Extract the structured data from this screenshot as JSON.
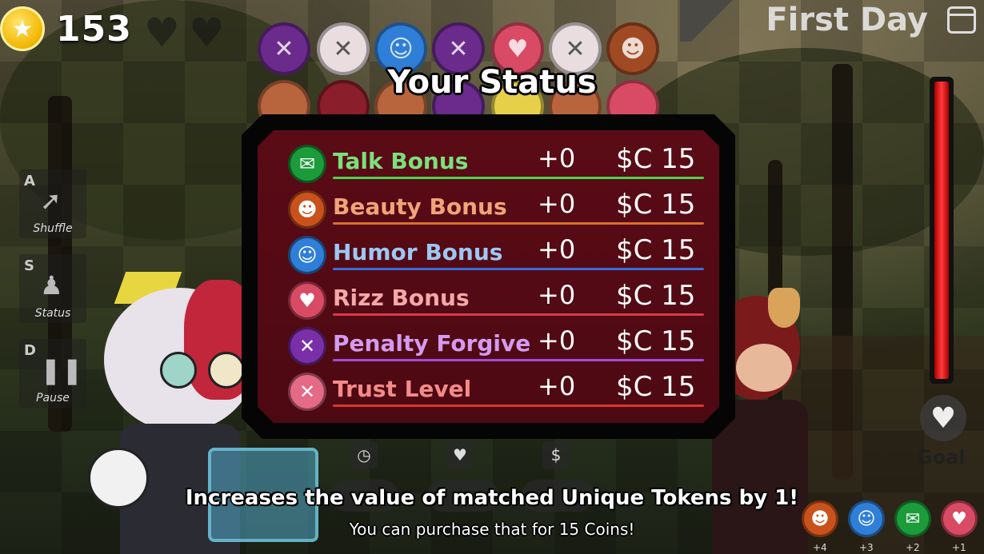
{
  "hud": {
    "coins": "153",
    "coin_icon": "star-coin-icon",
    "day_title": "First Day",
    "calendar_icon": "calendar-icon"
  },
  "controls": [
    {
      "key": "A",
      "label": "Shuffle",
      "icon": "shuffle-icon"
    },
    {
      "key": "S",
      "label": "Status",
      "icon": "status-icon"
    },
    {
      "key": "D",
      "label": "Pause",
      "icon": "pause-icon"
    }
  ],
  "status": {
    "title": "Your Status",
    "rows": [
      {
        "name": "Talk Bonus",
        "bonus": "+0",
        "price": "$C 15",
        "color": "#7be07b",
        "icon_color": "#1c9b3a",
        "icon": "speech-bubble-icon"
      },
      {
        "name": "Beauty Bonus",
        "bonus": "+0",
        "price": "$C 15",
        "color": "#f0a478",
        "icon_color": "#c9521c",
        "icon": "beauty-icon"
      },
      {
        "name": "Humor Bonus",
        "bonus": "+0",
        "price": "$C 15",
        "color": "#9cc8f4",
        "icon_color": "#2f7fd8",
        "icon": "smiley-icon"
      },
      {
        "name": "Rizz Bonus",
        "bonus": "+0",
        "price": "$C 15",
        "color": "#f4a8a8",
        "icon_color": "#d94a64",
        "icon": "heart-face-icon"
      },
      {
        "name": "Penalty Forgive",
        "bonus": "+0",
        "price": "$C 15",
        "color": "#d39af0",
        "icon_color": "#7a2fa8",
        "icon": "x-icon"
      },
      {
        "name": "Trust Level",
        "bonus": "+0",
        "price": "$C 15",
        "color": "#f48a8a",
        "icon_color": "#e46a86",
        "icon": "dizzy-face-icon"
      }
    ]
  },
  "goal": {
    "label": "Goal",
    "icon": "heart-icon"
  },
  "tooltip": {
    "main": "Increases the value of matched Unique Tokens by 1!",
    "sub": "You can purchase that for 15 Coins!"
  },
  "bottom_tokens": [
    {
      "count": "+4",
      "color": "#c9521c",
      "icon": "beauty-icon"
    },
    {
      "count": "+3",
      "color": "#2f7fd8",
      "icon": "smiley-icon"
    },
    {
      "count": "+2",
      "color": "#1c9b3a",
      "icon": "speech-bubble-icon"
    },
    {
      "count": "+1",
      "color": "#d94a64",
      "icon": "heart-face-icon"
    }
  ],
  "bottom_stat_icons": [
    "clock-icon",
    "heart-icon",
    "dollar-icon"
  ]
}
